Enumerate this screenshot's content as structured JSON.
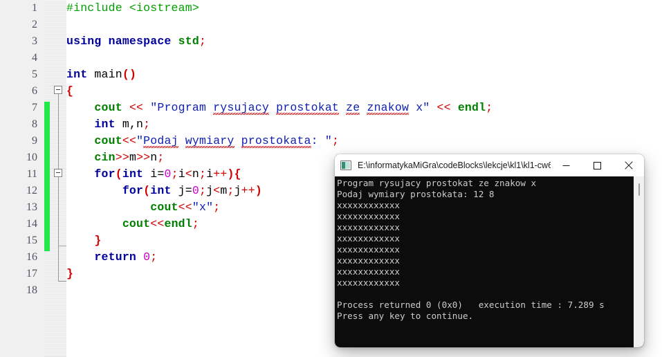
{
  "editor": {
    "name": "code-editor",
    "first_line": 1,
    "total_lines": 18,
    "colors": {
      "keyword": "#00009c",
      "type_keyword": "#008000",
      "preprocessor": "#00a000",
      "string": "#1020b0",
      "operator": "#d00000",
      "number": "#cc00cc",
      "gutter_bg": "#f0f0f0",
      "change_marker": "#22e84a",
      "editor_bg": "#ffffff"
    },
    "line_numbers": [
      "1",
      "2",
      "3",
      "4",
      "5",
      "6",
      "7",
      "8",
      "9",
      "10",
      "11",
      "12",
      "13",
      "14",
      "15",
      "16",
      "17",
      "18"
    ],
    "lines": [
      {
        "n": "1",
        "text": "#include <iostream>"
      },
      {
        "n": "2",
        "text": ""
      },
      {
        "n": "3",
        "text": "using namespace std;"
      },
      {
        "n": "4",
        "text": ""
      },
      {
        "n": "5",
        "text": "int main()"
      },
      {
        "n": "6",
        "text": "{"
      },
      {
        "n": "7",
        "text": "    cout << \"Program rysujacy prostokat ze znakow x\" << endl;"
      },
      {
        "n": "8",
        "text": "    int m,n;"
      },
      {
        "n": "9",
        "text": "    cout<<\"Podaj wymiary prostokata: \";"
      },
      {
        "n": "10",
        "text": "    cin>>m>>n;"
      },
      {
        "n": "11",
        "text": "    for(int i=0;i<n;i++){"
      },
      {
        "n": "12",
        "text": "        for(int j=0;j<m;j++)"
      },
      {
        "n": "13",
        "text": "            cout<<\"x\";"
      },
      {
        "n": "14",
        "text": "        cout<<endl;"
      },
      {
        "n": "15",
        "text": "    }"
      },
      {
        "n": "16",
        "text": "    return 0;"
      },
      {
        "n": "17",
        "text": "}"
      },
      {
        "n": "18",
        "text": ""
      }
    ],
    "change_marker": {
      "from_line": 7,
      "to_line": 15
    },
    "fold_markers": [
      {
        "line": 6,
        "state": "expanded"
      },
      {
        "line": 11,
        "state": "expanded"
      }
    ]
  },
  "console_window": {
    "title": "E:\\informatykaMiGra\\codeBlocks\\lekcje\\kl1\\kl1-cw6...",
    "icon": "console-icon",
    "buttons": {
      "minimize": "Minimize",
      "maximize": "Maximize",
      "close": "Close"
    },
    "background": "#0c0c0c",
    "foreground": "#ccccce",
    "output": "Program rysujacy prostokat ze znakow x\nPodaj wymiary prostokata: 12 8\nxxxxxxxxxxxx\nxxxxxxxxxxxx\nxxxxxxxxxxxx\nxxxxxxxxxxxx\nxxxxxxxxxxxx\nxxxxxxxxxxxx\nxxxxxxxxxxxx\nxxxxxxxxxxxx\n\nProcess returned 0 (0x0)   execution time : 7.289 s\nPress any key to continue.",
    "output_lines": [
      "Program rysujacy prostokat ze znakow x",
      "Podaj wymiary prostokata: 12 8",
      "xxxxxxxxxxxx",
      "xxxxxxxxxxxx",
      "xxxxxxxxxxxx",
      "xxxxxxxxxxxx",
      "xxxxxxxxxxxx",
      "xxxxxxxxxxxx",
      "xxxxxxxxxxxx",
      "xxxxxxxxxxxx",
      "",
      "Process returned 0 (0x0)   execution time : 7.289 s",
      "Press any key to continue."
    ],
    "input_values": {
      "m": "12",
      "n": "8"
    },
    "exit_code": "0 (0x0)",
    "execution_time": "7.289 s"
  }
}
